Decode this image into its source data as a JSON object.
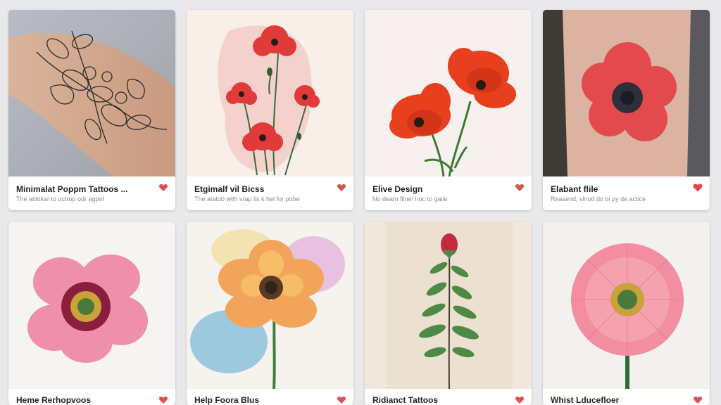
{
  "cards": [
    {
      "title": "Minimalat Poppm Tattoos ...",
      "subtitle": "The atilokar to octrop odr agpot",
      "heart_icon": "heart-icon",
      "heart_color": "#d9534f"
    },
    {
      "title": "Etgimalf vil Bicss",
      "subtitle": "The atatob with vrap lis k hel for pohe",
      "heart_icon": "heart-icon",
      "heart_color": "#d9534f"
    },
    {
      "title": "Elive Design",
      "subtitle": "No deam filne! lroc to gaile",
      "heart_icon": "heart-icon",
      "heart_color": "#d9534f"
    },
    {
      "title": "Elabant flile",
      "subtitle": "Reasend, vinod do bi py de actice",
      "heart_icon": "heart-icon",
      "heart_color": "#e2454e"
    },
    {
      "title": "Heme Rerhopvoos",
      "subtitle": "",
      "heart_icon": "heart-icon",
      "heart_color": "#d9534f"
    },
    {
      "title": "Help Foora Blus",
      "subtitle": "",
      "heart_icon": "heart-icon",
      "heart_color": "#d9534f"
    },
    {
      "title": "Ridianct Tattoos",
      "subtitle": "",
      "heart_icon": "heart-icon",
      "heart_color": "#d9534f"
    },
    {
      "title": "Whist Lducefloer",
      "subtitle": "",
      "heart_icon": "heart-icon",
      "heart_color": "#d9534f"
    }
  ]
}
